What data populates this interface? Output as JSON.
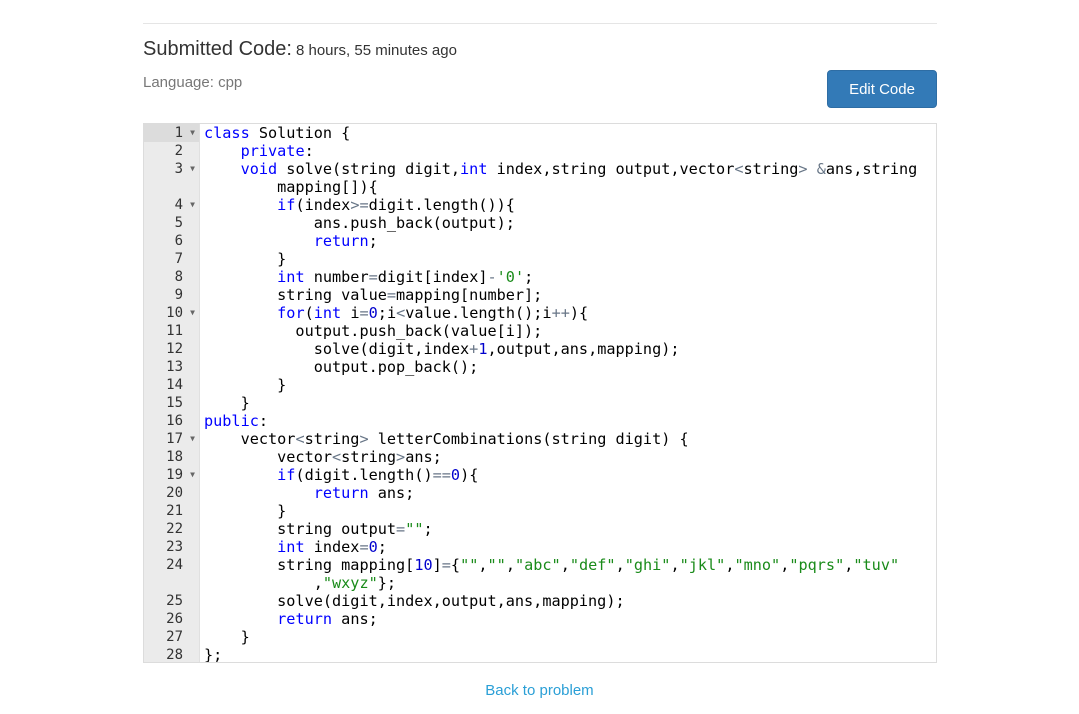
{
  "header": {
    "title": "Submitted Code:",
    "time_ago": "8 hours, 55 minutes ago",
    "language": "Language: cpp",
    "edit_button": "Edit Code"
  },
  "editor": {
    "active_line": 1,
    "rows": [
      {
        "n": "1",
        "fold": true,
        "tokens": [
          [
            "kw",
            "class"
          ],
          [
            "p",
            " Solution {"
          ]
        ]
      },
      {
        "n": "2",
        "fold": false,
        "tokens": [
          [
            "p",
            "    "
          ],
          [
            "kw",
            "private"
          ],
          [
            "p",
            ":"
          ]
        ]
      },
      {
        "n": "3",
        "fold": true,
        "tokens": [
          [
            "p",
            "    "
          ],
          [
            "kw",
            "void"
          ],
          [
            "p",
            " solve(string digit,"
          ],
          [
            "kw",
            "int"
          ],
          [
            "p",
            " index,string output,vector"
          ],
          [
            "op",
            "<"
          ],
          [
            "p",
            "string"
          ],
          [
            "op",
            ">"
          ],
          [
            "p",
            " "
          ],
          [
            "op",
            "&"
          ],
          [
            "p",
            "ans,string"
          ]
        ]
      },
      {
        "n": "",
        "fold": false,
        "tokens": [
          [
            "p",
            "        mapping[]){"
          ]
        ]
      },
      {
        "n": "4",
        "fold": true,
        "tokens": [
          [
            "p",
            "        "
          ],
          [
            "kw",
            "if"
          ],
          [
            "p",
            "(index"
          ],
          [
            "op",
            ">="
          ],
          [
            "p",
            "digit.length()){"
          ]
        ]
      },
      {
        "n": "5",
        "fold": false,
        "tokens": [
          [
            "p",
            "            ans.push_back(output);"
          ]
        ]
      },
      {
        "n": "6",
        "fold": false,
        "tokens": [
          [
            "p",
            "            "
          ],
          [
            "kw",
            "return"
          ],
          [
            "p",
            ";"
          ]
        ]
      },
      {
        "n": "7",
        "fold": false,
        "tokens": [
          [
            "p",
            "        }"
          ]
        ]
      },
      {
        "n": "8",
        "fold": false,
        "tokens": [
          [
            "p",
            "        "
          ],
          [
            "kw",
            "int"
          ],
          [
            "p",
            " number"
          ],
          [
            "op",
            "="
          ],
          [
            "p",
            "digit[index]"
          ],
          [
            "op",
            "-"
          ],
          [
            "str",
            "'0'"
          ],
          [
            "p",
            ";"
          ]
        ]
      },
      {
        "n": "9",
        "fold": false,
        "tokens": [
          [
            "p",
            "        string value"
          ],
          [
            "op",
            "="
          ],
          [
            "p",
            "mapping[number];"
          ]
        ]
      },
      {
        "n": "10",
        "fold": true,
        "tokens": [
          [
            "p",
            "        "
          ],
          [
            "kw",
            "for"
          ],
          [
            "p",
            "("
          ],
          [
            "kw",
            "int"
          ],
          [
            "p",
            " i"
          ],
          [
            "op",
            "="
          ],
          [
            "num",
            "0"
          ],
          [
            "p",
            ";i"
          ],
          [
            "op",
            "<"
          ],
          [
            "p",
            "value.length();i"
          ],
          [
            "op",
            "++"
          ],
          [
            "p",
            "){"
          ]
        ]
      },
      {
        "n": "11",
        "fold": false,
        "tokens": [
          [
            "p",
            "          output.push_back(value[i]);"
          ]
        ]
      },
      {
        "n": "12",
        "fold": false,
        "tokens": [
          [
            "p",
            "            solve(digit,index"
          ],
          [
            "op",
            "+"
          ],
          [
            "num",
            "1"
          ],
          [
            "p",
            ",output,ans,mapping);"
          ]
        ]
      },
      {
        "n": "13",
        "fold": false,
        "tokens": [
          [
            "p",
            "            output.pop_back();"
          ]
        ]
      },
      {
        "n": "14",
        "fold": false,
        "tokens": [
          [
            "p",
            "        }"
          ]
        ]
      },
      {
        "n": "15",
        "fold": false,
        "tokens": [
          [
            "p",
            "    }"
          ]
        ]
      },
      {
        "n": "16",
        "fold": false,
        "tokens": [
          [
            "kw",
            "public"
          ],
          [
            "p",
            ":"
          ]
        ]
      },
      {
        "n": "17",
        "fold": true,
        "tokens": [
          [
            "p",
            "    vector"
          ],
          [
            "op",
            "<"
          ],
          [
            "p",
            "string"
          ],
          [
            "op",
            ">"
          ],
          [
            "p",
            " letterCombinations(string digit) {"
          ]
        ]
      },
      {
        "n": "18",
        "fold": false,
        "tokens": [
          [
            "p",
            "        vector"
          ],
          [
            "op",
            "<"
          ],
          [
            "p",
            "string"
          ],
          [
            "op",
            ">"
          ],
          [
            "p",
            "ans;"
          ]
        ]
      },
      {
        "n": "19",
        "fold": true,
        "tokens": [
          [
            "p",
            "        "
          ],
          [
            "kw",
            "if"
          ],
          [
            "p",
            "(digit.length()"
          ],
          [
            "op",
            "=="
          ],
          [
            "num",
            "0"
          ],
          [
            "p",
            "){"
          ]
        ]
      },
      {
        "n": "20",
        "fold": false,
        "tokens": [
          [
            "p",
            "            "
          ],
          [
            "kw",
            "return"
          ],
          [
            "p",
            " ans;"
          ]
        ]
      },
      {
        "n": "21",
        "fold": false,
        "tokens": [
          [
            "p",
            "        }"
          ]
        ]
      },
      {
        "n": "22",
        "fold": false,
        "tokens": [
          [
            "p",
            "        string output"
          ],
          [
            "op",
            "="
          ],
          [
            "str",
            "\"\""
          ],
          [
            "p",
            ";"
          ]
        ]
      },
      {
        "n": "23",
        "fold": false,
        "tokens": [
          [
            "p",
            "        "
          ],
          [
            "kw",
            "int"
          ],
          [
            "p",
            " index"
          ],
          [
            "op",
            "="
          ],
          [
            "num",
            "0"
          ],
          [
            "p",
            ";"
          ]
        ]
      },
      {
        "n": "24",
        "fold": false,
        "tokens": [
          [
            "p",
            "        string mapping["
          ],
          [
            "num",
            "10"
          ],
          [
            "p",
            "]"
          ],
          [
            "op",
            "="
          ],
          [
            "p",
            "{"
          ],
          [
            "str",
            "\"\""
          ],
          [
            "p",
            ","
          ],
          [
            "str",
            "\"\""
          ],
          [
            "p",
            ","
          ],
          [
            "str",
            "\"abc\""
          ],
          [
            "p",
            ","
          ],
          [
            "str",
            "\"def\""
          ],
          [
            "p",
            ","
          ],
          [
            "str",
            "\"ghi\""
          ],
          [
            "p",
            ","
          ],
          [
            "str",
            "\"jkl\""
          ],
          [
            "p",
            ","
          ],
          [
            "str",
            "\"mno\""
          ],
          [
            "p",
            ","
          ],
          [
            "str",
            "\"pqrs\""
          ],
          [
            "p",
            ","
          ],
          [
            "str",
            "\"tuv\""
          ]
        ]
      },
      {
        "n": "",
        "fold": false,
        "tokens": [
          [
            "p",
            "            ,"
          ],
          [
            "str",
            "\"wxyz\""
          ],
          [
            "p",
            "};"
          ]
        ]
      },
      {
        "n": "25",
        "fold": false,
        "tokens": [
          [
            "p",
            "        solve(digit,index,output,ans,mapping);"
          ]
        ]
      },
      {
        "n": "26",
        "fold": false,
        "tokens": [
          [
            "p",
            "        "
          ],
          [
            "kw",
            "return"
          ],
          [
            "p",
            " ans;"
          ]
        ]
      },
      {
        "n": "27",
        "fold": false,
        "tokens": [
          [
            "p",
            "    }"
          ]
        ]
      },
      {
        "n": "28",
        "fold": false,
        "tokens": [
          [
            "p",
            "};"
          ]
        ]
      }
    ]
  },
  "footer": {
    "back_link": "Back to problem"
  }
}
